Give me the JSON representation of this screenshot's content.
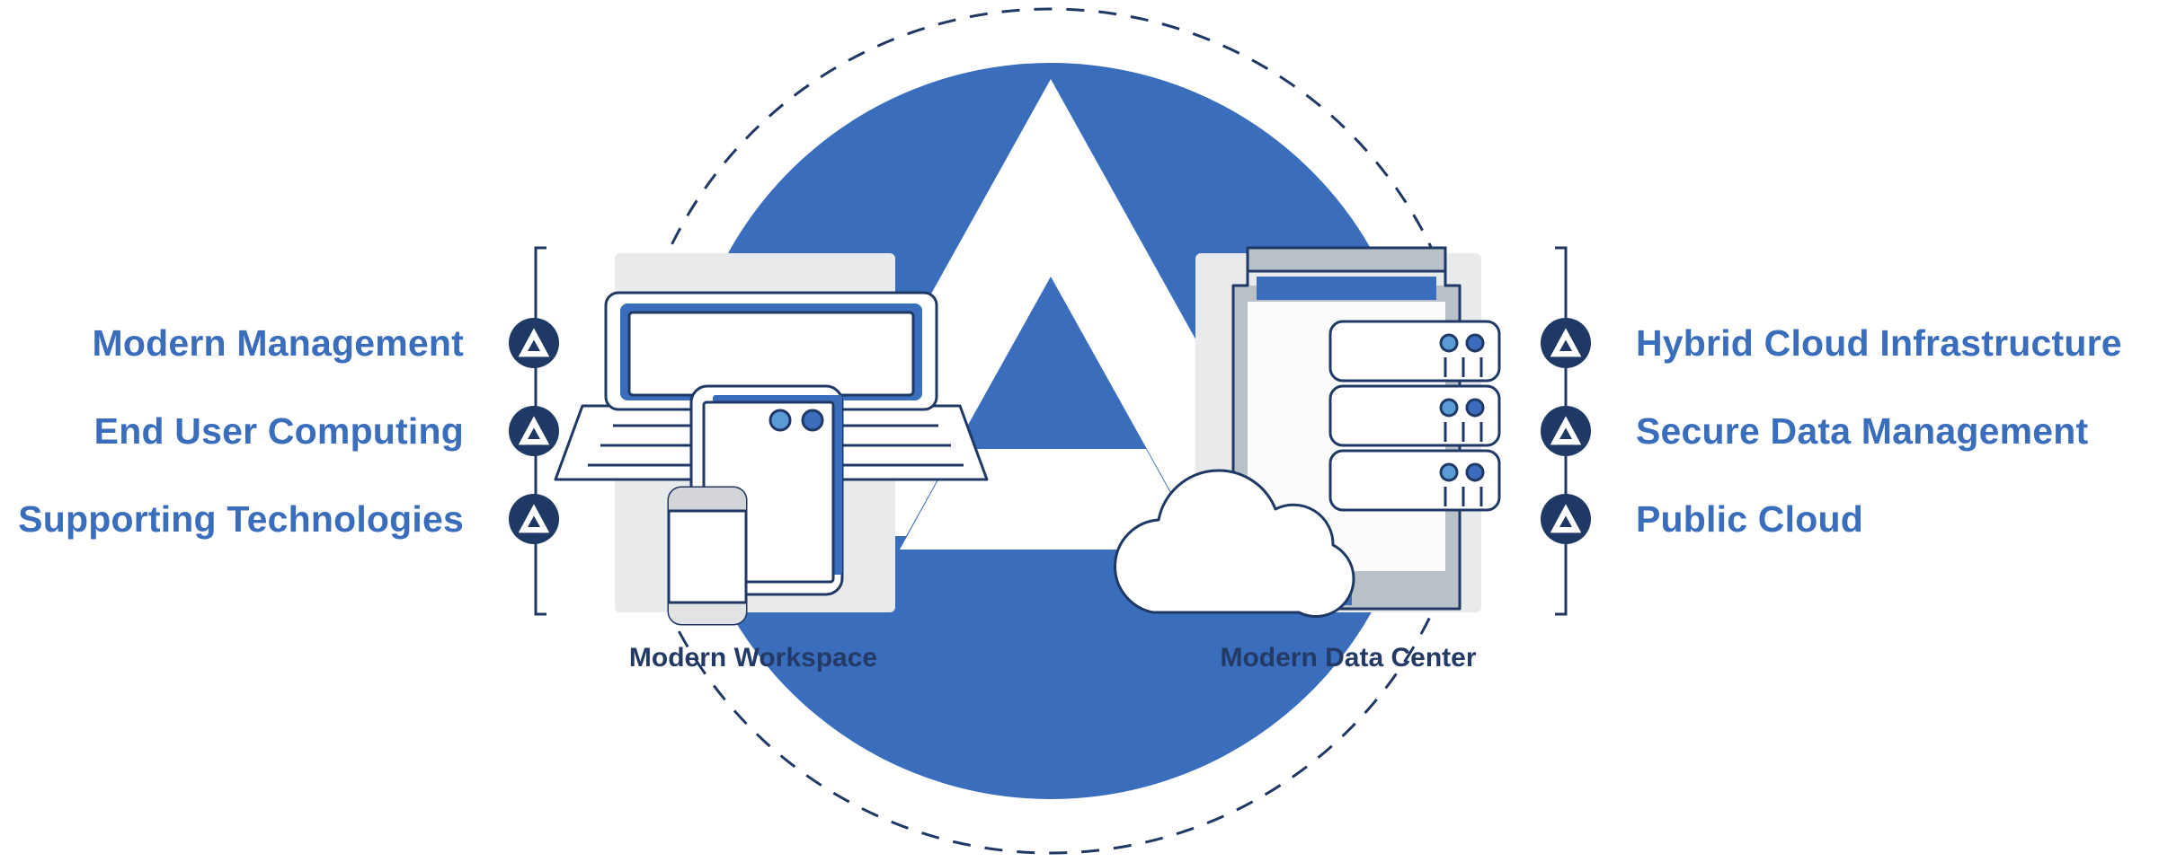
{
  "diagram": {
    "title": "Modern Workspace and Modern Data Center",
    "colors": {
      "circle_blue": "#3A6DBC",
      "navy": "#1F3864",
      "dark_navy": "#233A66",
      "label_blue": "#3A6DBC",
      "light_gray": "#E9EAEC",
      "mid_gray": "#D3D5D8",
      "rack_gray": "#B8C0C8",
      "accent_light_blue": "#5B9BD5",
      "white": "#FFFFFF"
    },
    "center_logo": {
      "icon": "apex-a-logo-icon",
      "description": "white chevron A mark on blue circle"
    },
    "background": {
      "outer_ring": "dashed-circle",
      "inner_circle": "solid-blue-circle"
    }
  },
  "left_group": {
    "bracket": "left-bracket",
    "caption": "Modern Workspace",
    "illustration": "workspace-devices-illustration",
    "items": [
      {
        "label": "Modern Management",
        "icon": "apex-a-logo-icon"
      },
      {
        "label": "End User Computing",
        "icon": "apex-a-logo-icon"
      },
      {
        "label": "Supporting Technologies",
        "icon": "apex-a-logo-icon"
      }
    ]
  },
  "right_group": {
    "bracket": "right-bracket",
    "caption": "Modern Data Center",
    "illustration": "data-center-rack-illustration",
    "items": [
      {
        "label": "Hybrid Cloud Infrastructure",
        "icon": "apex-a-logo-icon"
      },
      {
        "label": "Secure Data Management",
        "icon": "apex-a-logo-icon"
      },
      {
        "label": "Public Cloud",
        "icon": "apex-a-logo-icon"
      }
    ]
  }
}
